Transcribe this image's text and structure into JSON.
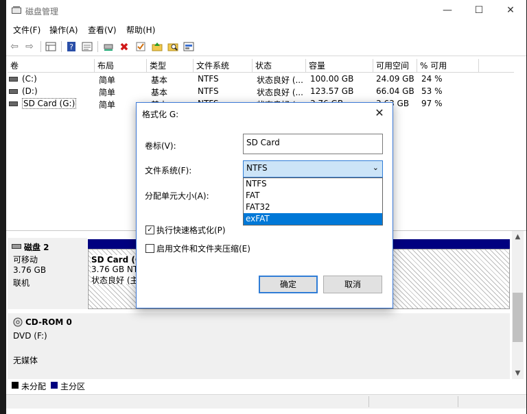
{
  "window": {
    "title": "磁盘管理"
  },
  "menu": [
    "文件(F)",
    "操作(A)",
    "查看(V)",
    "帮助(H)"
  ],
  "toolbar": {
    "icons": [
      "back-arrow-icon",
      "forward-arrow-icon",
      "disk-list-icon",
      "help-icon",
      "properties-icon",
      "connect-icon",
      "delete-icon",
      "check-icon",
      "up-folder-icon",
      "search-icon",
      "disk-view-icon"
    ]
  },
  "table": {
    "columns": [
      "卷",
      "布局",
      "类型",
      "文件系统",
      "状态",
      "容量",
      "可用空间",
      "% 可用"
    ],
    "rows": [
      [
        "(C:)",
        "简单",
        "基本",
        "NTFS",
        "状态良好 (...",
        "100.00 GB",
        "24.09 GB",
        "24 %"
      ],
      [
        "(D:)",
        "简单",
        "基本",
        "NTFS",
        "状态良好 (...",
        "123.57 GB",
        "66.04 GB",
        "53 %"
      ],
      [
        "SD Card (G:)",
        "简单",
        "基本",
        "NTFS",
        "状态良好 (...",
        "3.76 GB",
        "3.63 GB",
        "97 %"
      ]
    ]
  },
  "disks": [
    {
      "name": "磁盘 2",
      "type": "可移动",
      "size": "3.76 GB",
      "state": "联机",
      "volume": {
        "name": "SD Card (G:)",
        "line2": "3.76 GB NTFS",
        "line3": "状态良好 (主分区)"
      }
    },
    {
      "name": "CD-ROM 0",
      "type": "DVD (F:)",
      "size": "",
      "state": "无媒体"
    }
  ],
  "legend": [
    {
      "label": "未分配",
      "color": "#000000"
    },
    {
      "label": "主分区",
      "color": "#000080"
    }
  ],
  "dialog": {
    "title": "格式化 G:",
    "volume_label_caption": "卷标(V):",
    "volume_label_value": "SD Card",
    "fs_caption": "文件系统(F):",
    "fs_selected": "NTFS",
    "alloc_caption": "分配单元大小(A):",
    "fs_options": [
      "NTFS",
      "FAT",
      "FAT32",
      "exFAT"
    ],
    "fs_highlighted_index": 3,
    "quick_format_label": "执行快速格式化(P)",
    "quick_format_checked": true,
    "compress_label": "启用文件和文件夹压缩(E)",
    "compress_checked": false,
    "ok_label": "确定",
    "cancel_label": "取消"
  }
}
